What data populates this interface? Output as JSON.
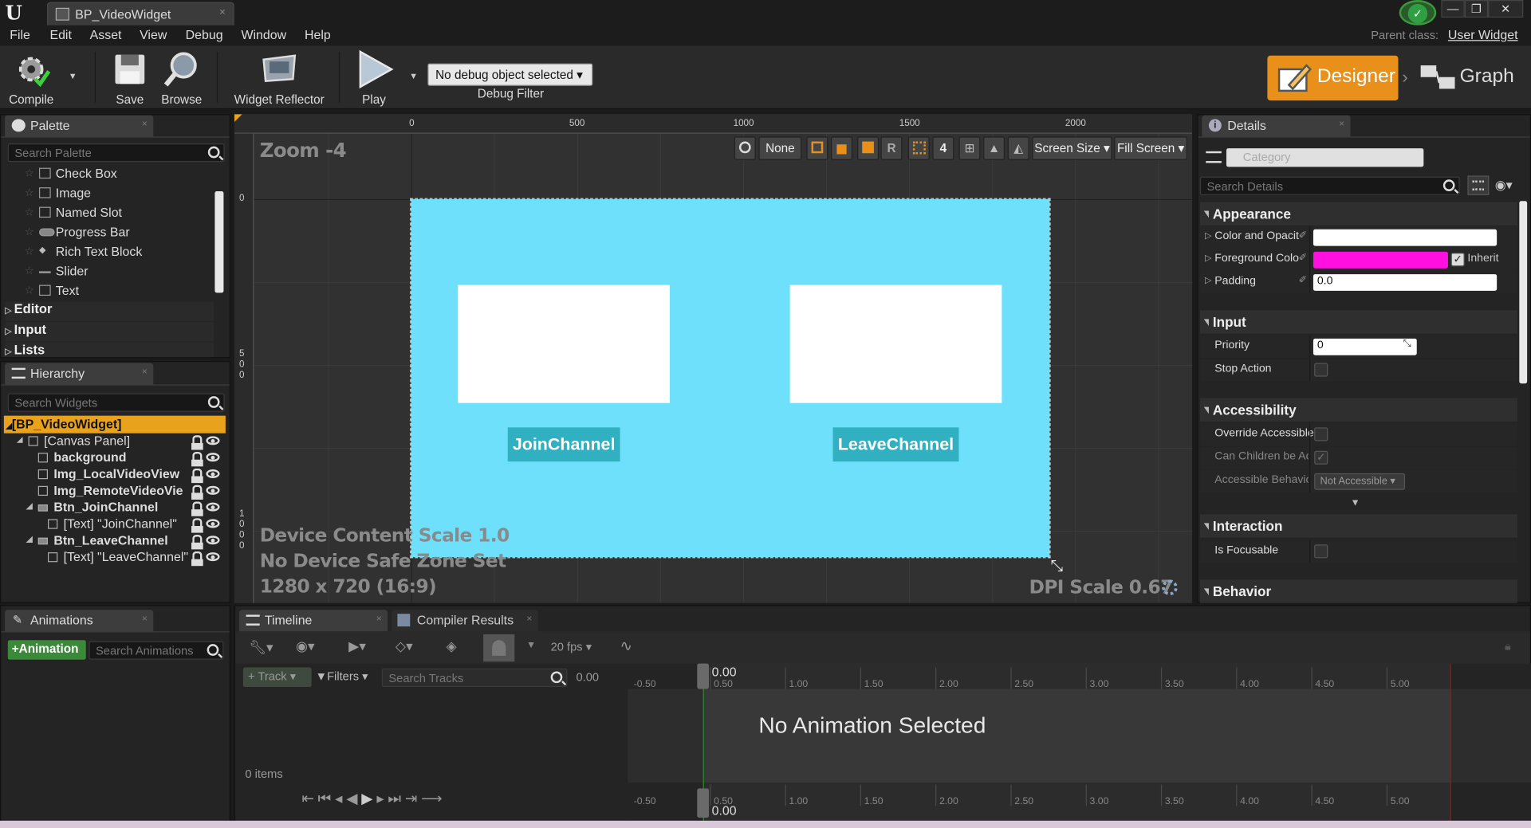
{
  "titlebar": {
    "tab_title": "BP_VideoWidget",
    "close": "×",
    "window_buttons": [
      "—",
      "❐",
      "✕"
    ]
  },
  "menubar": {
    "items": [
      "File",
      "Edit",
      "Asset",
      "View",
      "Debug",
      "Window",
      "Help"
    ],
    "parent_class_label": "Parent class:",
    "parent_class_value": "User Widget"
  },
  "toolbar": {
    "compile": "Compile",
    "save": "Save",
    "browse": "Browse",
    "widget_reflector": "Widget Reflector",
    "play": "Play",
    "debug_object": "No debug object selected",
    "debug_filter": "Debug Filter",
    "designer": "Designer",
    "graph": "Graph"
  },
  "palette": {
    "tab": "Palette",
    "search_placeholder": "Search Palette",
    "items": [
      "Check Box",
      "Image",
      "Named Slot",
      "Progress Bar",
      "Rich Text Block",
      "Slider",
      "Text"
    ],
    "categories": [
      "Editor",
      "Input",
      "Lists"
    ]
  },
  "hierarchy": {
    "tab": "Hierarchy",
    "search_placeholder": "Search Widgets",
    "root": "[BP_VideoWidget]",
    "items": [
      "[Canvas Panel]",
      "background",
      "Img_LocalVideoView",
      "Img_RemoteVideoVie",
      "Btn_JoinChannel",
      "[Text] \"JoinChannel\"",
      "Btn_LeaveChannel",
      "[Text] \"LeaveChannel\""
    ]
  },
  "viewport": {
    "zoom": "Zoom -4",
    "ruler_top": [
      "0",
      "500",
      "1000",
      "1500",
      "2000"
    ],
    "ruler_left_0": "0",
    "ruler_left_500": [
      "5",
      "0",
      "0"
    ],
    "ruler_left_1000": [
      "1",
      "0",
      "0",
      "0"
    ],
    "toolbar": {
      "none": "None",
      "r": "R",
      "grid_size": "4",
      "screen_size": "Screen Size",
      "fill_screen": "Fill Screen"
    },
    "join_label": "JoinChannel",
    "leave_label": "LeaveChannel",
    "device_scale": "Device Content Scale 1.0",
    "safe_zone": "No Device Safe Zone Set",
    "resolution": "1280 x 720 (16:9)",
    "dpi": "DPI Scale 0.67"
  },
  "details": {
    "tab": "Details",
    "category_placeholder": "Category",
    "search_placeholder": "Search Details",
    "appearance": "Appearance",
    "color_opacity": "Color and Opacit",
    "foreground": "Foreground Colo",
    "inherit": "Inherit",
    "padding": "Padding",
    "padding_value": "0.0",
    "input": "Input",
    "priority": "Priority",
    "priority_value": "0",
    "stop_action": "Stop Action",
    "accessibility": "Accessibility",
    "override_accessible": "Override Accessible",
    "can_children": "Can Children be Acc",
    "accessible_behavior": "Accessible Behavior",
    "accessible_value": "Not Accessible",
    "interaction": "Interaction",
    "is_focusable": "Is Focusable",
    "behavior": "Behavior",
    "colors": {
      "foreground": "#ff10e0",
      "color_opacity": "#ffffff"
    }
  },
  "animations": {
    "tab": "Animations",
    "add_button": "Animation",
    "search_placeholder": "Search Animations"
  },
  "timeline": {
    "tab_timeline": "Timeline",
    "tab_compiler": "Compiler Results",
    "fps": "20 fps",
    "track": "Track",
    "filters": "Filters",
    "search_placeholder": "Search Tracks",
    "time_value": "0.00",
    "playhead": "0.00",
    "empty": "No Animation Selected",
    "items_count": "0 items",
    "ticks": [
      "-0.50",
      "0.50",
      "1.00",
      "1.50",
      "2.00",
      "2.50",
      "3.00",
      "3.50",
      "4.00",
      "4.50",
      "5.00"
    ]
  }
}
